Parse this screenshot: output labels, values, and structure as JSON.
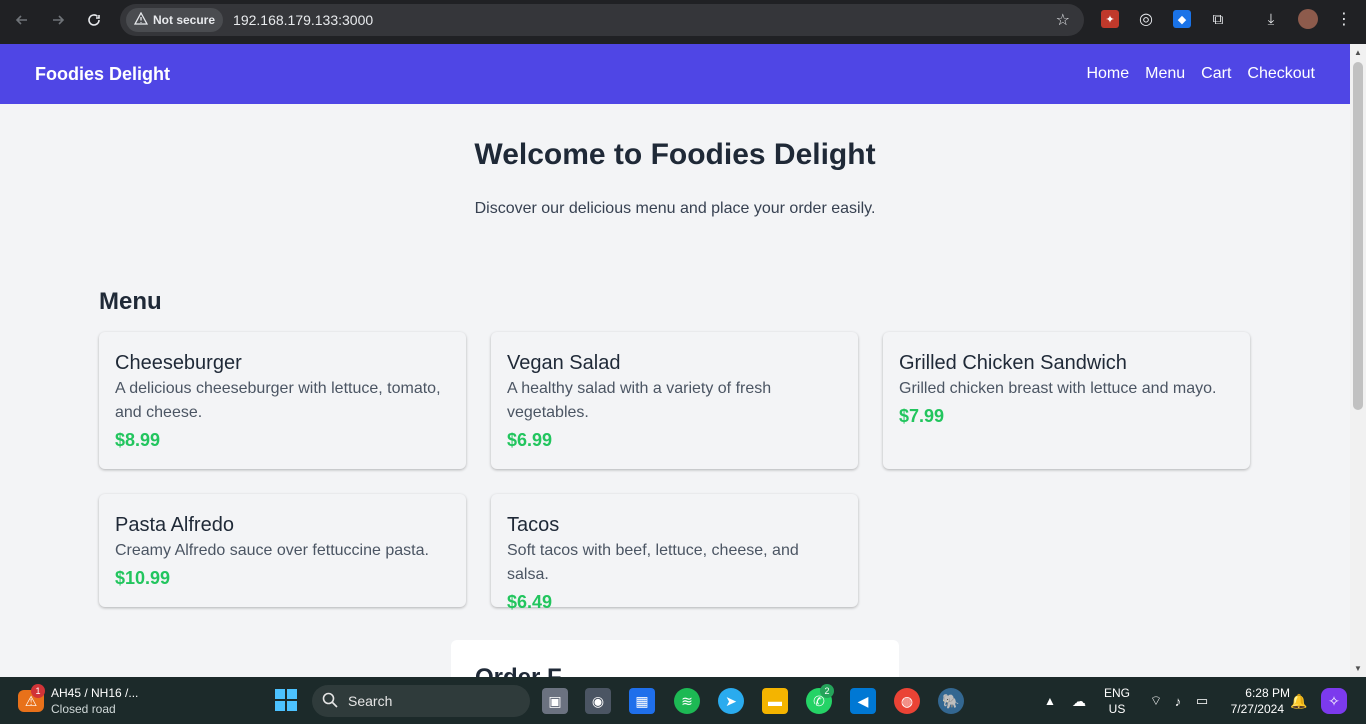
{
  "browser": {
    "security_label": "Not secure",
    "url": "192.168.179.133:3000"
  },
  "site": {
    "brand": "Foodies Delight",
    "nav": [
      "Home",
      "Menu",
      "Cart",
      "Checkout"
    ],
    "colors": {
      "header": "#4f46e5",
      "price": "#22c55e"
    }
  },
  "hero": {
    "title": "Welcome to Foodies Delight",
    "subtitle": "Discover our delicious menu and place your order easily."
  },
  "menu": {
    "title": "Menu",
    "items": [
      {
        "name": "Cheeseburger",
        "description": "A delicious cheeseburger with lettuce, tomato, and cheese.",
        "price": "$8.99"
      },
      {
        "name": "Vegan Salad",
        "description": "A healthy salad with a variety of fresh vegetables.",
        "price": "$6.99"
      },
      {
        "name": "Grilled Chicken Sandwich",
        "description": "Grilled chicken breast with lettuce and mayo.",
        "price": "$7.99"
      },
      {
        "name": "Pasta Alfredo",
        "description": "Creamy Alfredo sauce over fettuccine pasta.",
        "price": "$10.99"
      },
      {
        "name": "Tacos",
        "description": "Soft tacos with beef, lettuce, cheese, and salsa.",
        "price": "$6.49"
      }
    ]
  },
  "order_form": {
    "title": "Order F"
  },
  "taskbar": {
    "weather_badge": "1",
    "traffic_title": "AH45 / NH16 /...",
    "traffic_status": "Closed road",
    "search_label": "Search",
    "whatsapp_badge": "2",
    "lang_top": "ENG",
    "lang_bottom": "US",
    "time": "6:28 PM",
    "date": "7/27/2024"
  }
}
